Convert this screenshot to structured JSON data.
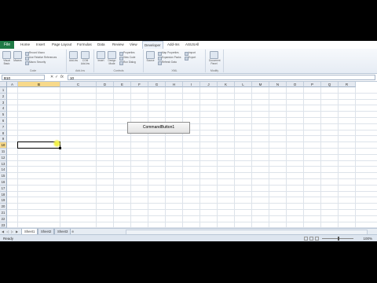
{
  "tabs": {
    "file": "File",
    "items": [
      "Home",
      "Insert",
      "Page Layout",
      "Formulas",
      "Data",
      "Review",
      "View",
      "Developer",
      "Add-Ins",
      "ASUSAll"
    ],
    "active_index": 7
  },
  "ribbon": {
    "code": {
      "label": "Code",
      "visual_basic": "Visual Basic",
      "macros": "Macros",
      "record_macro": "Record Macro",
      "relative_refs": "Use Relative References",
      "macro_security": "Macro Security"
    },
    "addins": {
      "label": "Add-Ins",
      "addins": "Add-Ins",
      "com_addins": "COM Add-Ins"
    },
    "controls": {
      "label": "Controls",
      "insert": "Insert",
      "design_mode": "Design Mode",
      "properties": "Properties",
      "view_code": "View Code",
      "run_dialog": "Run Dialog"
    },
    "xml": {
      "label": "XML",
      "source": "Source",
      "map_properties": "Map Properties",
      "expansion_packs": "Expansion Packs",
      "refresh_data": "Refresh Data",
      "import": "Import",
      "export": "Export"
    },
    "modify": {
      "label": "Modify",
      "document_panel": "Document Panel"
    }
  },
  "formula_bar": {
    "name_box": "B10",
    "cancel": "✕",
    "enter": "✓",
    "fx": "fx",
    "value": "10"
  },
  "columns": [
    "A",
    "B",
    "C",
    "D",
    "E",
    "F",
    "G",
    "H",
    "I",
    "J",
    "K",
    "L",
    "M",
    "N",
    "O",
    "P",
    "Q",
    "R"
  ],
  "rows": [
    "1",
    "2",
    "3",
    "4",
    "5",
    "6",
    "7",
    "8",
    "9",
    "10",
    "11",
    "12",
    "13",
    "14",
    "15",
    "16",
    "17",
    "18",
    "19",
    "20",
    "21",
    "22",
    "23",
    "24",
    "25"
  ],
  "selected_col": "B",
  "selected_row": "10",
  "command_button": "CommandButton1",
  "sheets": [
    "Sheet1",
    "Sheet2",
    "Sheet3"
  ],
  "active_sheet": 0,
  "status": {
    "mode": "Ready",
    "zoom": "100%"
  },
  "icons": {
    "save": "save-icon",
    "undo": "undo-icon",
    "redo": "redo-icon"
  }
}
